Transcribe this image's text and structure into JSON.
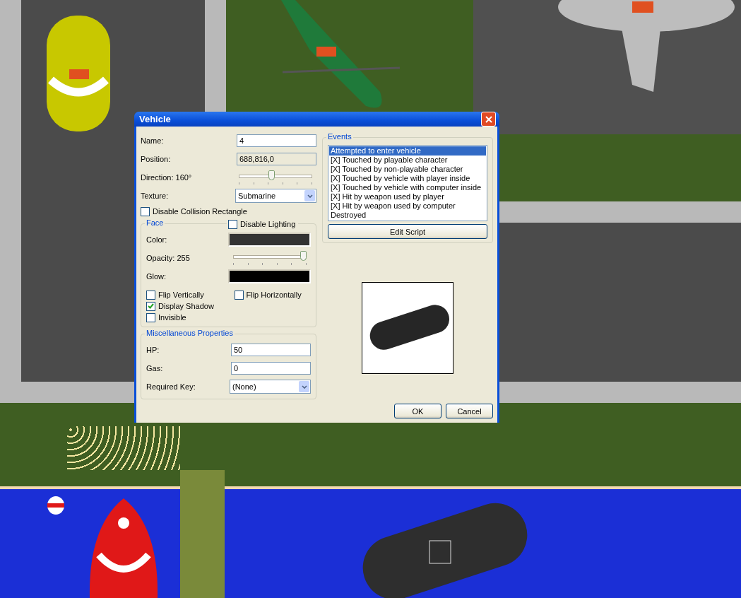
{
  "window": {
    "title": "Vehicle"
  },
  "fields": [
    {
      "kind": "text",
      "label": "Name:",
      "value": "4"
    },
    {
      "kind": "readonly",
      "label": "Position:",
      "value": "688,816,0"
    },
    {
      "kind": "slider",
      "label": "Direction: 160°",
      "level": 0.44
    },
    {
      "kind": "dropdown",
      "label": "Texture:",
      "value": "Submarine"
    }
  ],
  "disable_collision": {
    "label": "Disable Collision Rectangle",
    "checked": false
  },
  "face": {
    "title": "Face",
    "disable_lighting": {
      "label": "Disable Lighting",
      "checked": false
    },
    "rows": [
      {
        "kind": "color",
        "label": "Color:",
        "color": "#333333"
      },
      {
        "kind": "slider",
        "label": "Opacity: 255",
        "level": 1
      },
      {
        "kind": "color",
        "label": "Glow:",
        "color": "#000000"
      }
    ],
    "checkboxes_left": [
      {
        "label": "Flip Vertically",
        "checked": false
      },
      {
        "label": "Display Shadow",
        "checked": true
      },
      {
        "label": "Invisible",
        "checked": false
      }
    ],
    "checkboxes_right": [
      {
        "label": "Flip Horizontally",
        "checked": false
      }
    ]
  },
  "misc": {
    "title": "Miscellaneous Properties",
    "rows": [
      {
        "kind": "text",
        "label": "HP:",
        "value": "50"
      },
      {
        "kind": "text",
        "label": "Gas:",
        "value": "0"
      },
      {
        "kind": "dropdown",
        "label": "Required Key:",
        "value": "(None)"
      }
    ]
  },
  "events": {
    "title": "Events",
    "items": [
      {
        "label": "Attempted to enter vehicle",
        "selected": true
      },
      {
        "label": "[X] Touched by playable character",
        "selected": false
      },
      {
        "label": "[X] Touched by non-playable character",
        "selected": false
      },
      {
        "label": "[X] Touched by vehicle with player inside",
        "selected": false
      },
      {
        "label": "[X] Touched by vehicle with computer inside",
        "selected": false
      },
      {
        "label": "[X] Hit by weapon used by player",
        "selected": false
      },
      {
        "label": "[X] Hit by weapon used by computer",
        "selected": false
      },
      {
        "label": "Destroyed",
        "selected": false
      }
    ],
    "button": "Edit Script"
  },
  "buttons": [
    "OK",
    "Cancel"
  ]
}
